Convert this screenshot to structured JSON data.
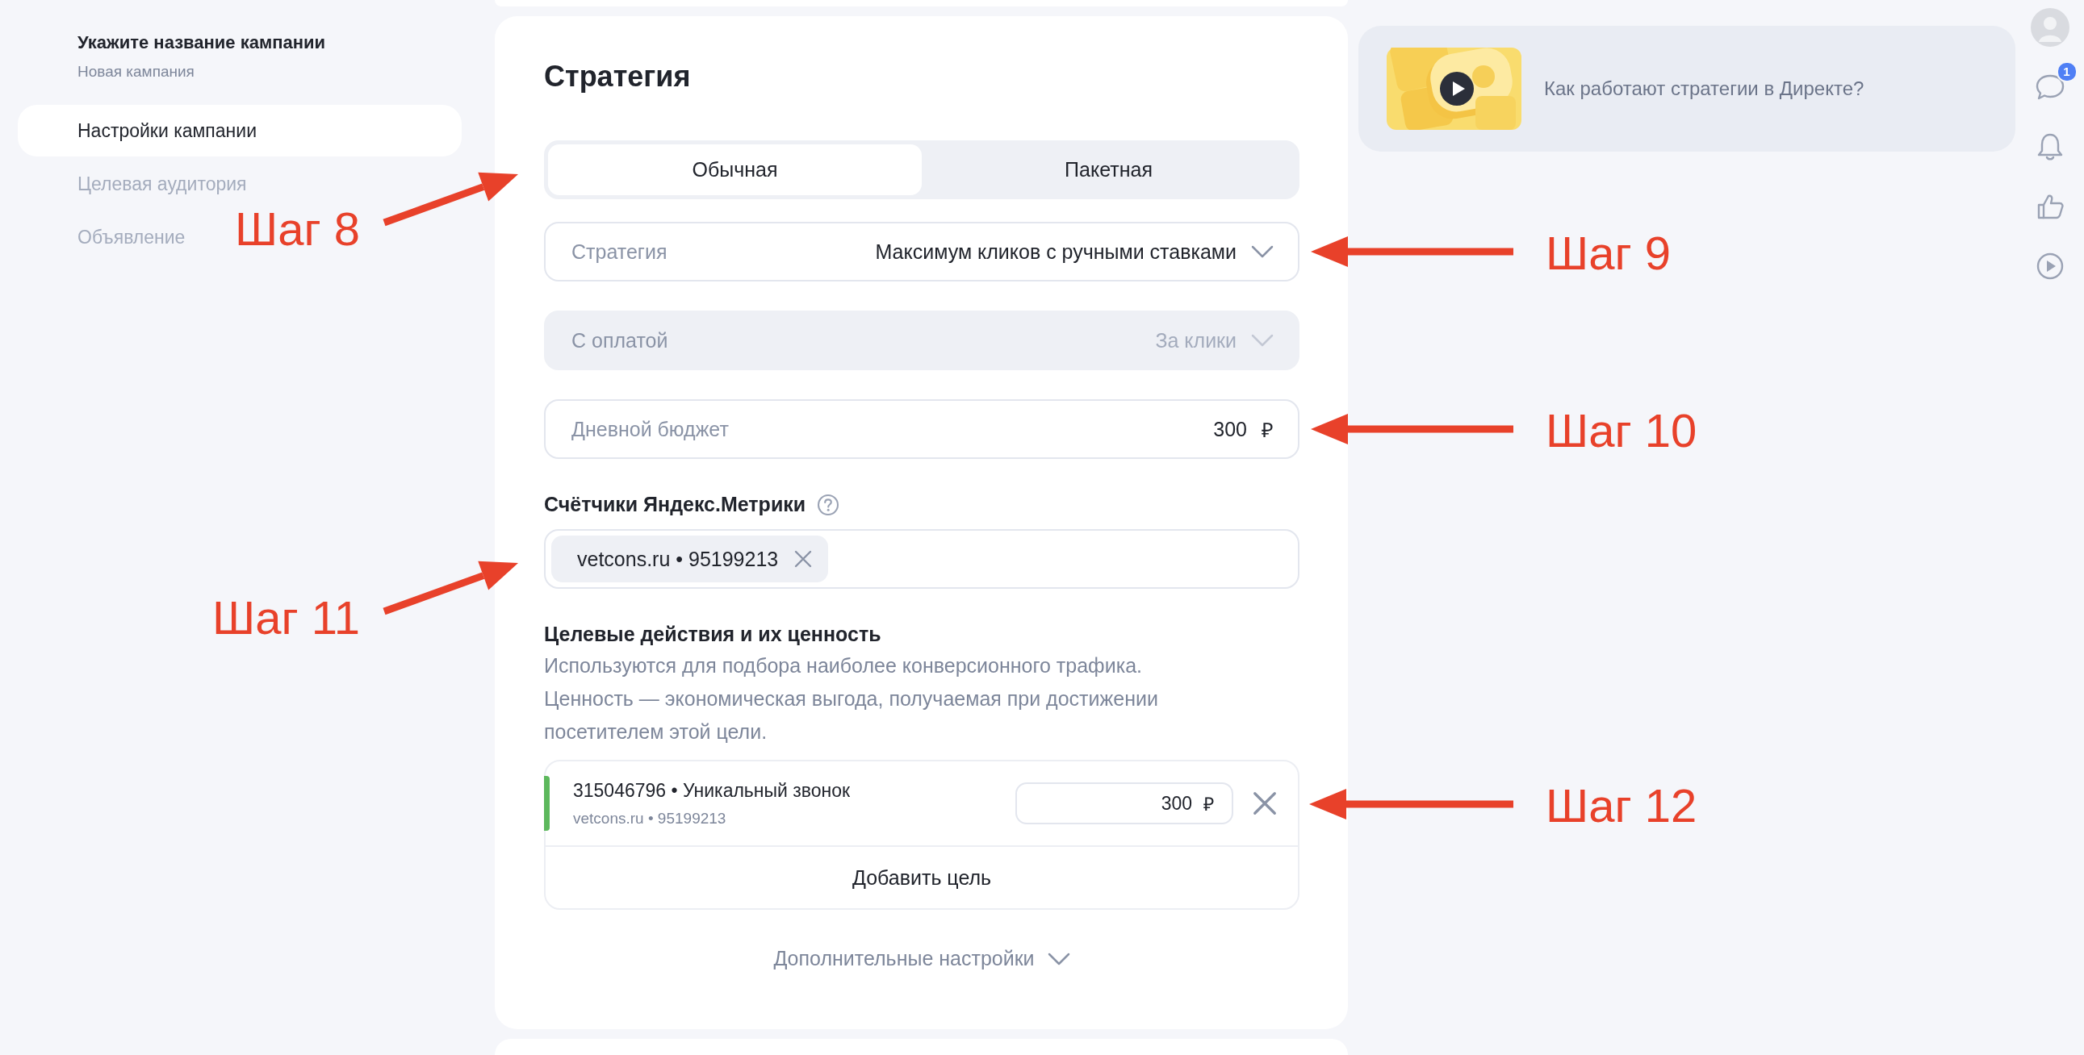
{
  "sidebar": {
    "title": "Укажите название кампании",
    "subtitle": "Новая кампания",
    "items": [
      {
        "label": "Настройки кампании",
        "selected": true
      },
      {
        "label": "Целевая аудитория",
        "selected": false
      },
      {
        "label": "Объявление",
        "selected": false
      }
    ]
  },
  "strategy": {
    "title": "Стратегия",
    "tabs": [
      {
        "label": "Обычная",
        "selected": true
      },
      {
        "label": "Пакетная",
        "selected": false
      }
    ],
    "tabs_annotation": "Шаг 8",
    "fields": [
      {
        "kind": "select",
        "label": "Стратегия",
        "value": "Максимум кликов с ручными ставками",
        "disabled": false,
        "annotation": "Шаг 9"
      },
      {
        "kind": "select",
        "label": "С оплатой",
        "value": "За клики",
        "disabled": true
      },
      {
        "kind": "input",
        "label": "Дневной бюджет",
        "value": "300",
        "unit": "₽",
        "disabled": false,
        "annotation": "Шаг 10"
      }
    ],
    "counters": {
      "label": "Счётчики Яндекс.Метрики",
      "tags": [
        "vetcons.ru • 95199213"
      ],
      "annotation": "Шаг 11"
    },
    "goals": {
      "title": "Целевые действия и их ценность",
      "description": "Используются для подбора наиболее конверсионного трафика. Ценность — экономическая выгода, получаемая при достижении посетителем этой цели.",
      "items": [
        {
          "name": "315046796 • Уникальный звонок",
          "source": "vetcons.ru • 95199213",
          "value": "300",
          "unit": "₽",
          "color": "#5cb85c",
          "annotation": "Шаг 12"
        }
      ],
      "add_button": "Добавить цель"
    },
    "more_settings": "Дополнительные настройки"
  },
  "video": {
    "title": "Как работают стратегии в Директе?"
  },
  "rail": [
    {
      "kind": "avatar"
    },
    {
      "kind": "chat",
      "badge": "1"
    },
    {
      "kind": "bell"
    },
    {
      "kind": "like"
    },
    {
      "kind": "play"
    }
  ]
}
